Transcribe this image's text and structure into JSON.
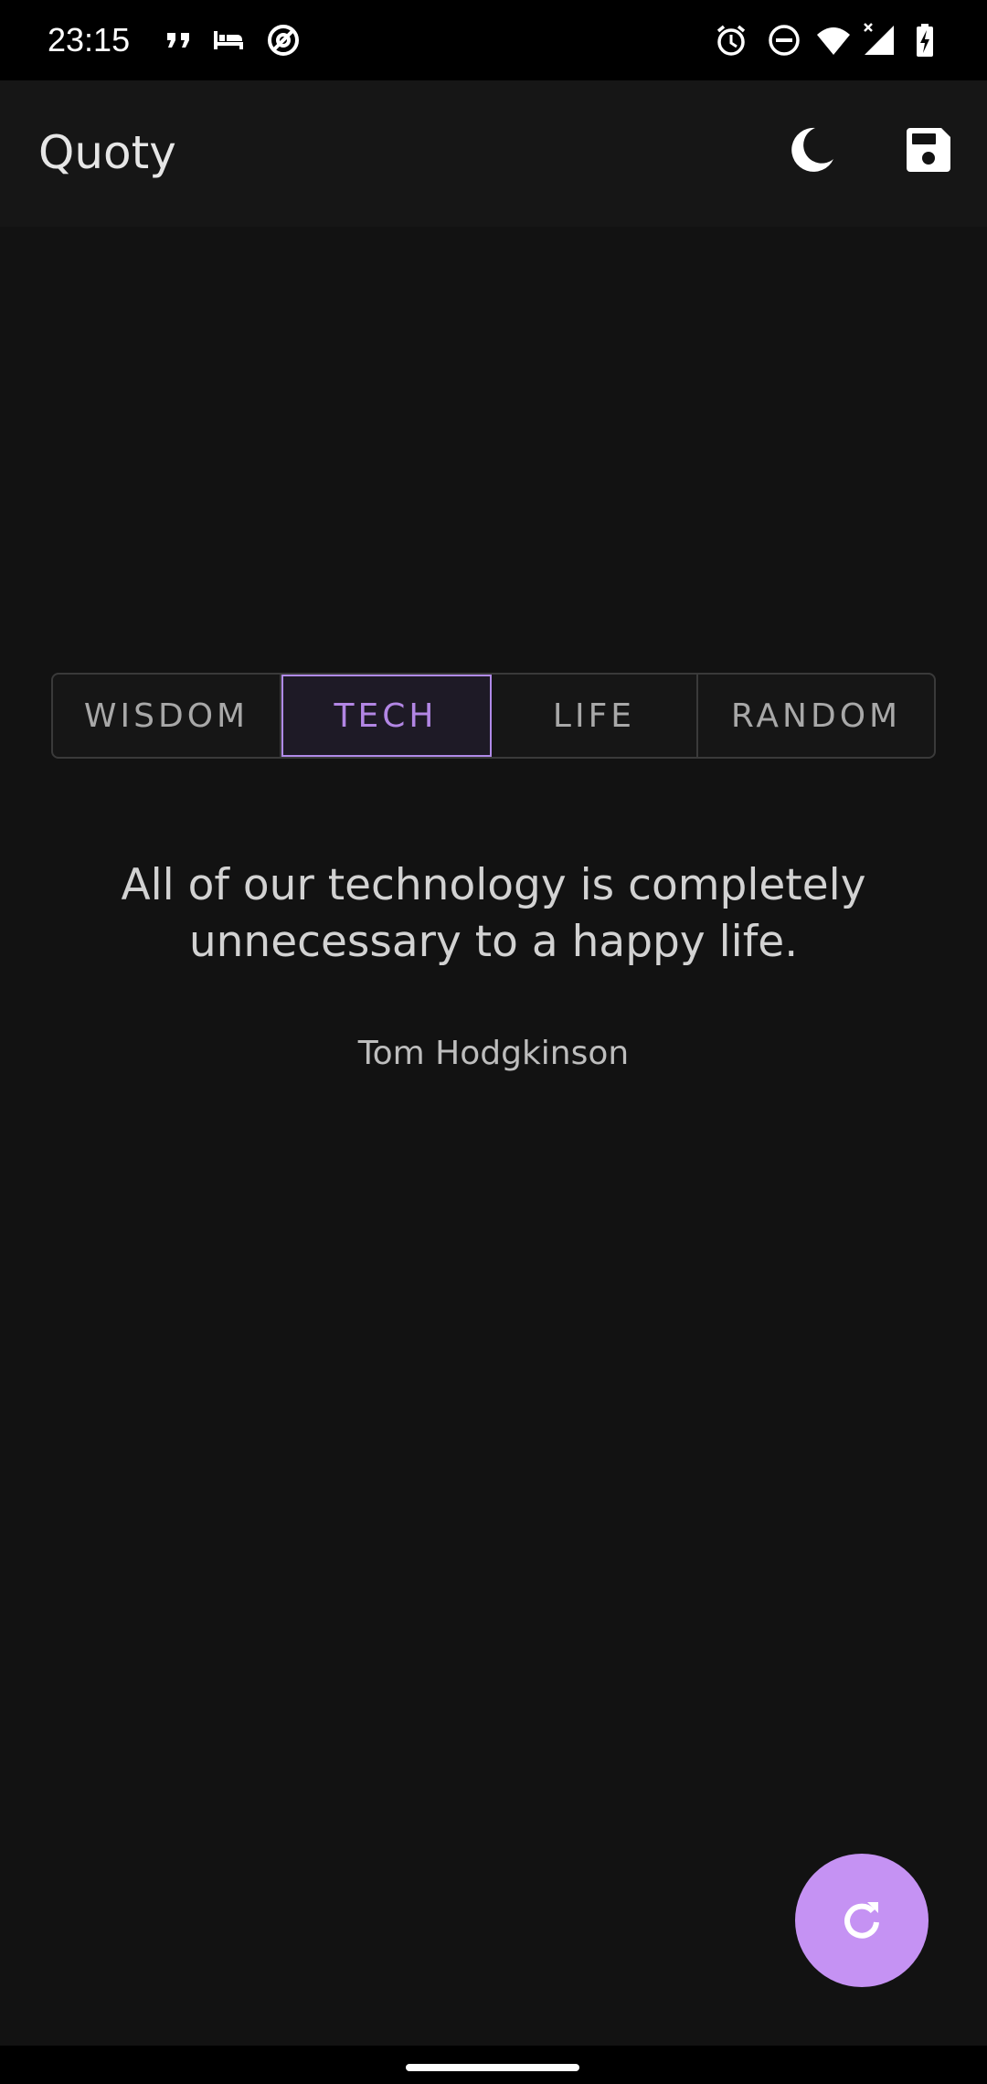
{
  "status_bar": {
    "time": "23:15",
    "left_icons": [
      "quote-icon",
      "bed-icon",
      "no-tracking-icon"
    ],
    "right_icons": [
      "alarm-icon",
      "do-not-disturb-icon",
      "wifi-icon",
      "signal-icon",
      "battery-charging-icon"
    ]
  },
  "app_bar": {
    "title": "Quoty",
    "actions": [
      "dark-mode-icon",
      "save-icon"
    ]
  },
  "categories": {
    "items": [
      {
        "label": "WISDOM",
        "selected": false
      },
      {
        "label": "TECH",
        "selected": true
      },
      {
        "label": "LIFE",
        "selected": false
      },
      {
        "label": "RANDOM",
        "selected": false
      }
    ]
  },
  "quote": {
    "text": "All of our technology is completely unnecessary to a happy life.",
    "author": "Tom Hodgkinson"
  },
  "fab": {
    "icon": "refresh-icon"
  },
  "colors": {
    "background": "#121212",
    "accent": "#c592f3",
    "selected_text": "#b286e4"
  }
}
